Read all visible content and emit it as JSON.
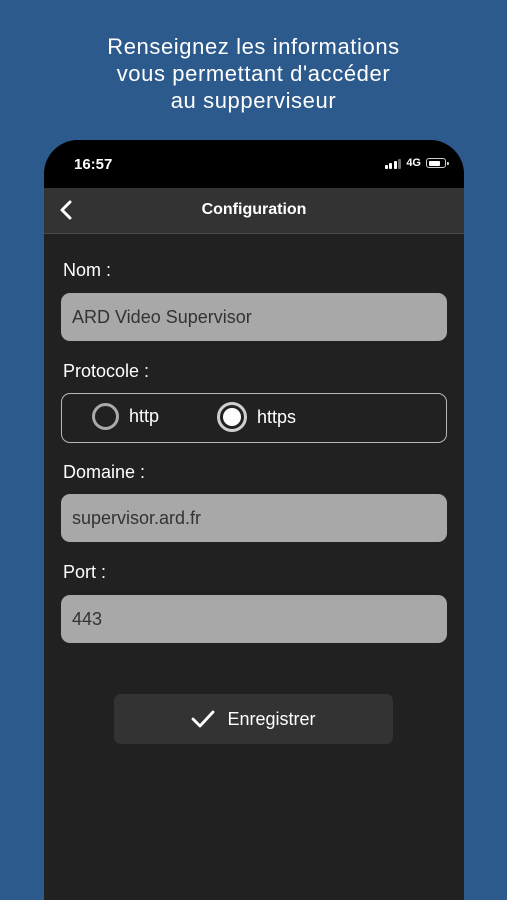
{
  "promo": {
    "lines": [
      "Renseignez les informations",
      "vous permettant d'accéder",
      "au supperviseur"
    ]
  },
  "status_bar": {
    "time": "16:57",
    "network": "4G"
  },
  "nav": {
    "title": "Configuration",
    "back_icon": "chevron-left-icon"
  },
  "form": {
    "name_label": "Nom :",
    "name_value": "ARD Video Supervisor",
    "protocol_label": "Protocole :",
    "protocol_options": [
      "http",
      "https"
    ],
    "protocol_selected": "https",
    "domain_label": "Domaine :",
    "domain_value": "supervisor.ard.fr",
    "port_label": "Port :",
    "port_value": "443"
  },
  "save_button": {
    "label": "Enregistrer",
    "icon": "checkmark-icon"
  },
  "colors": {
    "background": "#2d5a8c",
    "screen": "#212121",
    "nav_bar": "#333333",
    "field": "#a8a8a8"
  }
}
